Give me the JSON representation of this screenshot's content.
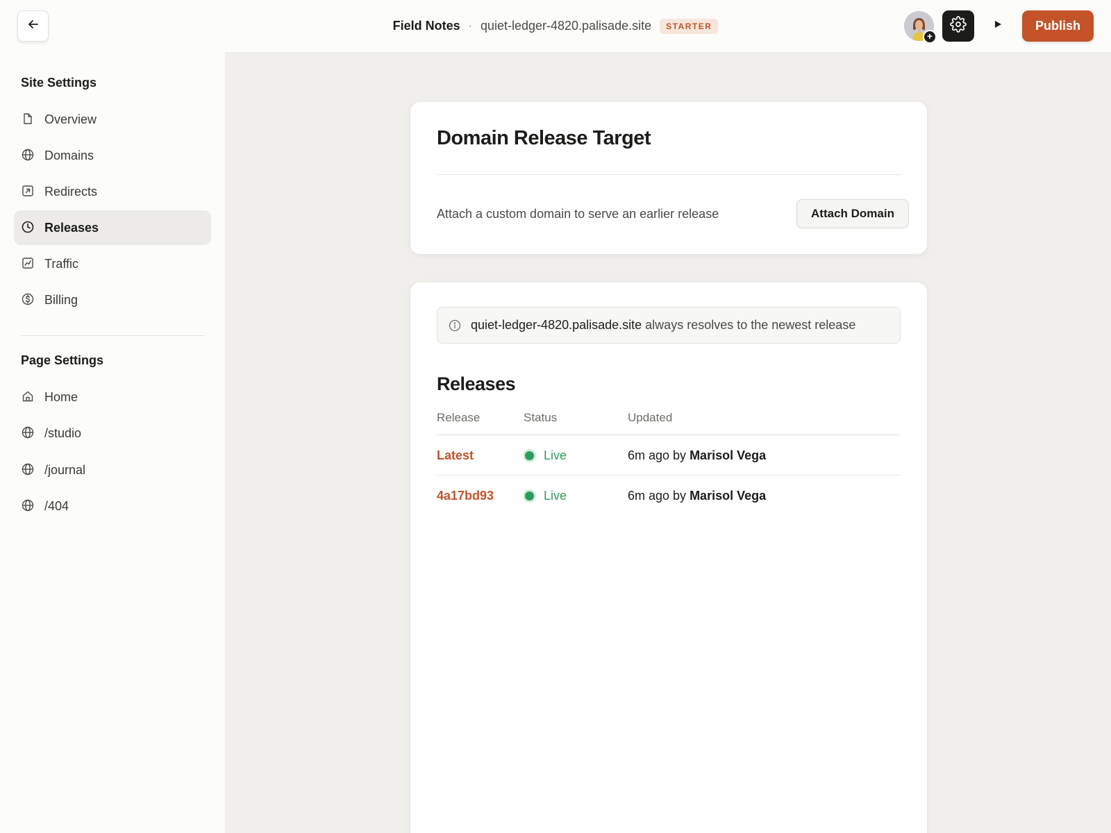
{
  "header": {
    "site_name": "Field Notes",
    "separator": "·",
    "site_domain": "quiet-ledger-4820.palisade.site",
    "plan_badge": "STARTER",
    "publish_label": "Publish",
    "add_collaborator": "+",
    "accent_color": "#c4532a"
  },
  "sidebar": {
    "site_settings_title": "Site Settings",
    "site_items": [
      {
        "label": "Overview",
        "icon": "file-icon"
      },
      {
        "label": "Domains",
        "icon": "globe-icon"
      },
      {
        "label": "Redirects",
        "icon": "redirect-icon"
      },
      {
        "label": "Releases",
        "icon": "clock-icon",
        "active": true
      },
      {
        "label": "Traffic",
        "icon": "chart-icon"
      },
      {
        "label": "Billing",
        "icon": "dollar-icon"
      }
    ],
    "page_settings_title": "Page Settings",
    "page_items": [
      {
        "label": "Home",
        "icon": "home-icon"
      },
      {
        "label": "/studio",
        "icon": "globe-icon"
      },
      {
        "label": "/journal",
        "icon": "globe-icon"
      },
      {
        "label": "/404",
        "icon": "globe-icon"
      }
    ]
  },
  "domain_target": {
    "title": "Domain Release Target",
    "description": "Attach a custom domain to serve an earlier release",
    "attach_label": "Attach Domain"
  },
  "info": {
    "domain": "quiet-ledger-4820.palisade.site",
    "text": " always resolves to the newest release"
  },
  "releases": {
    "title": "Releases",
    "columns": [
      "Release",
      "Status",
      "Updated"
    ],
    "rows": [
      {
        "release": "Latest",
        "status": "Live",
        "updated": "6m ago by ",
        "author": "Marisol Vega"
      },
      {
        "release": "4a17bd93",
        "status": "Live",
        "updated": "6m ago by ",
        "author": "Marisol Vega"
      }
    ],
    "status_color": "#2e9b5e"
  }
}
